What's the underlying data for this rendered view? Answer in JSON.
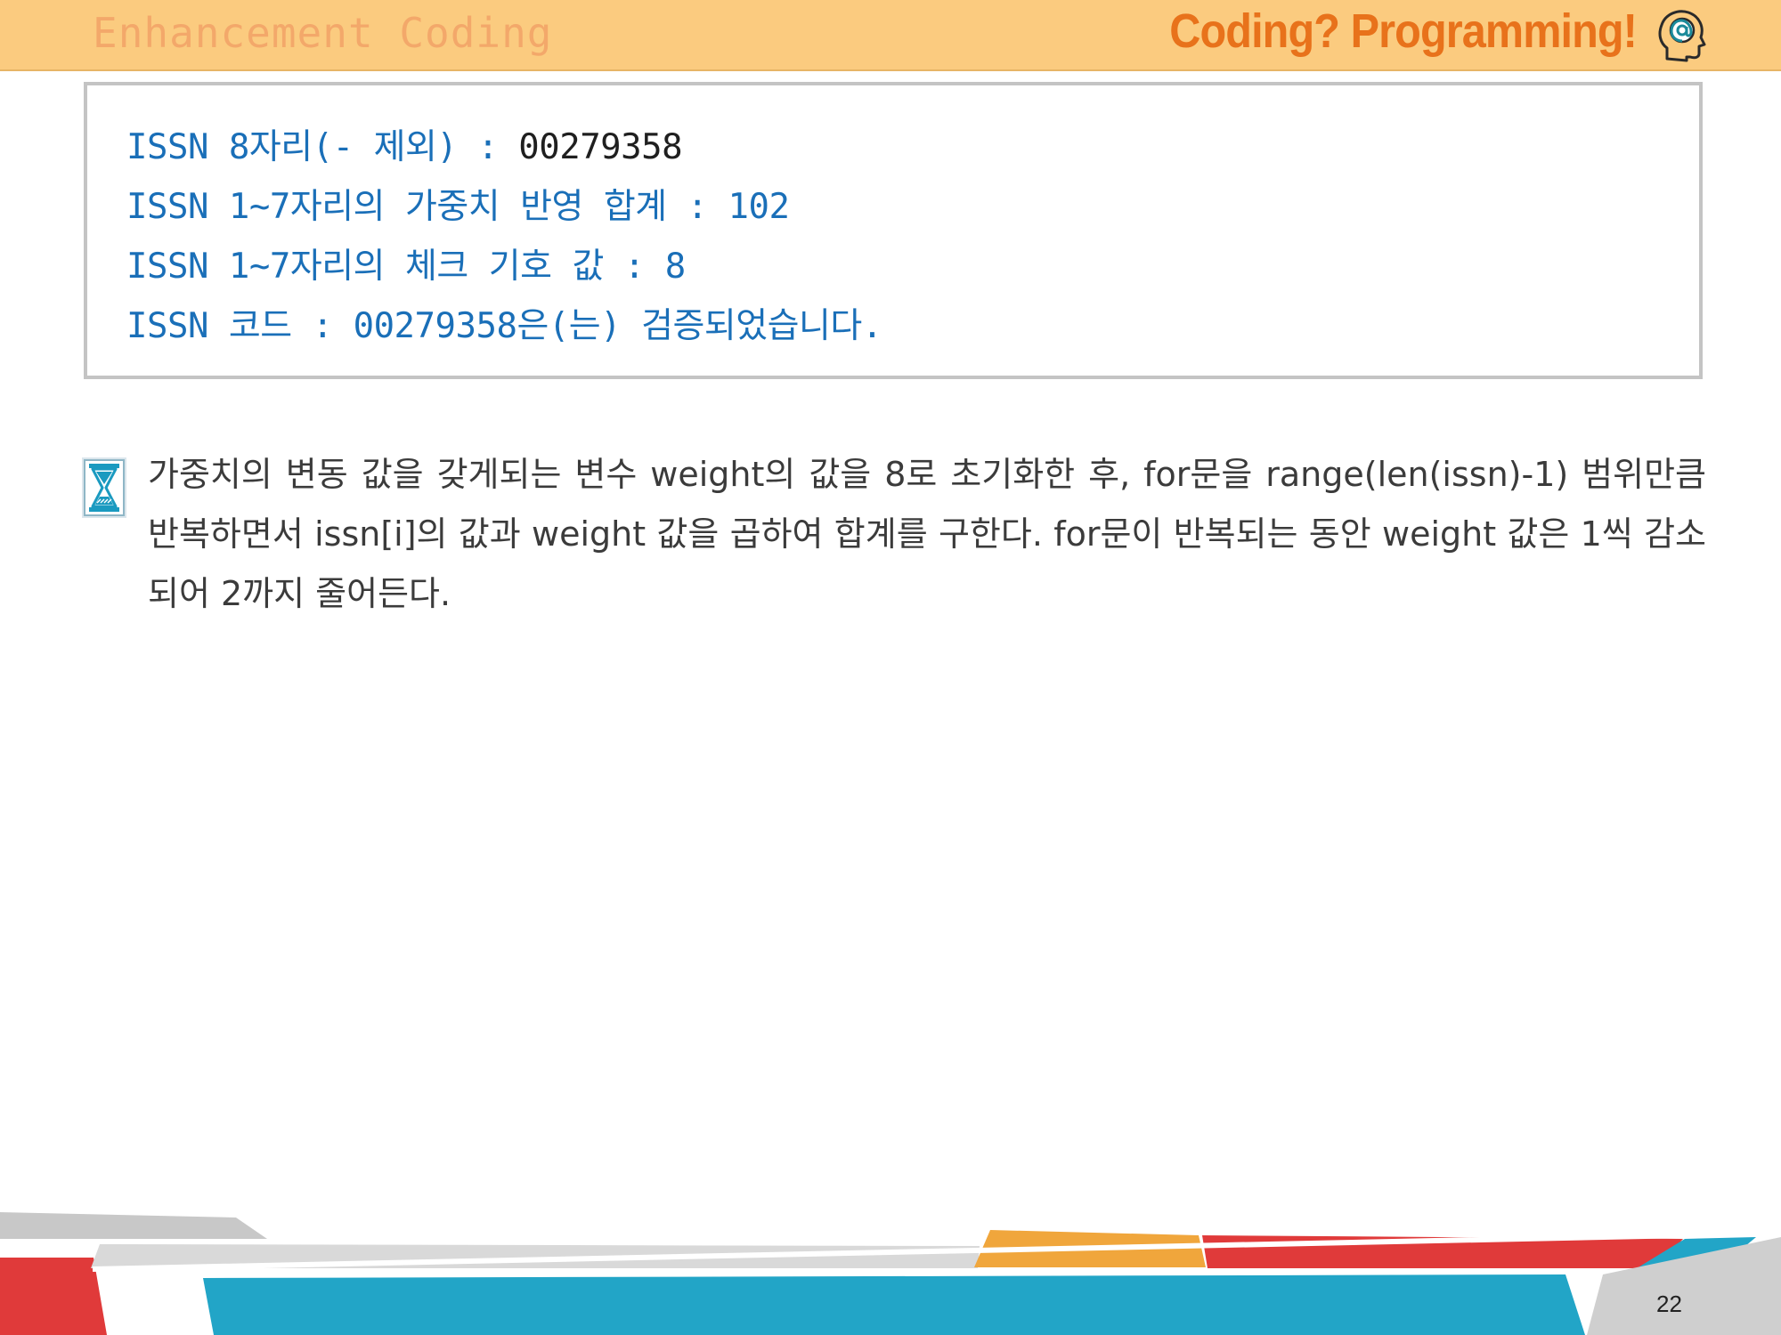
{
  "header": {
    "left_title": "Enhancement Coding",
    "right_title": "Coding? Programming!",
    "icon": "head-at-sign-icon"
  },
  "output": {
    "lines": [
      {
        "label": "ISSN 8자리(- 제외) : ",
        "value": "00279358"
      },
      {
        "label": "ISSN 1~7자리의 가중치 반영 합계 : 102",
        "value": ""
      },
      {
        "label": "ISSN 1~7자리의 체크 기호 값 : 8",
        "value": ""
      },
      {
        "label": "ISSN 코드 : 00279358은(는) 검증되었습니다.",
        "value": ""
      }
    ]
  },
  "note": {
    "icon": "hourglass-icon",
    "text": "가중치의 변동 값을 갖게되는 변수 weight의 값을 8로 초기화한 후, for문을 range(len(issn)-1) 범위만큼 반복하면서 issn[i]의 값과 weight 값을 곱하여 합계를 구한다. for문이 반복되는 동안 weight 값은 1씩 감소되어 2까지 줄어든다."
  },
  "footer": {
    "page_number": "22"
  },
  "colors": {
    "header_bg": "#fbcb7f",
    "header_title": "#e8721b",
    "output_text": "#1a6fb8",
    "footer_blue": "#22a5c7",
    "footer_red": "#e03a3a",
    "footer_orange": "#f0a63c",
    "footer_gray": "#d6d6d6"
  }
}
